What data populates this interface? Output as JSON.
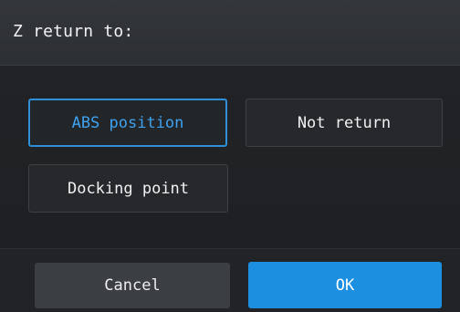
{
  "dialog": {
    "title": "Z return to:"
  },
  "options": {
    "abs_position": {
      "label": "ABS position",
      "selected": true
    },
    "not_return": {
      "label": "Not return",
      "selected": false
    },
    "docking_point": {
      "label": "Docking point",
      "selected": false
    }
  },
  "actions": {
    "cancel_label": "Cancel",
    "ok_label": "OK"
  },
  "colors": {
    "accent": "#1d8fe0",
    "selected_text": "#3ea2f0",
    "background": "#1d1f22"
  }
}
